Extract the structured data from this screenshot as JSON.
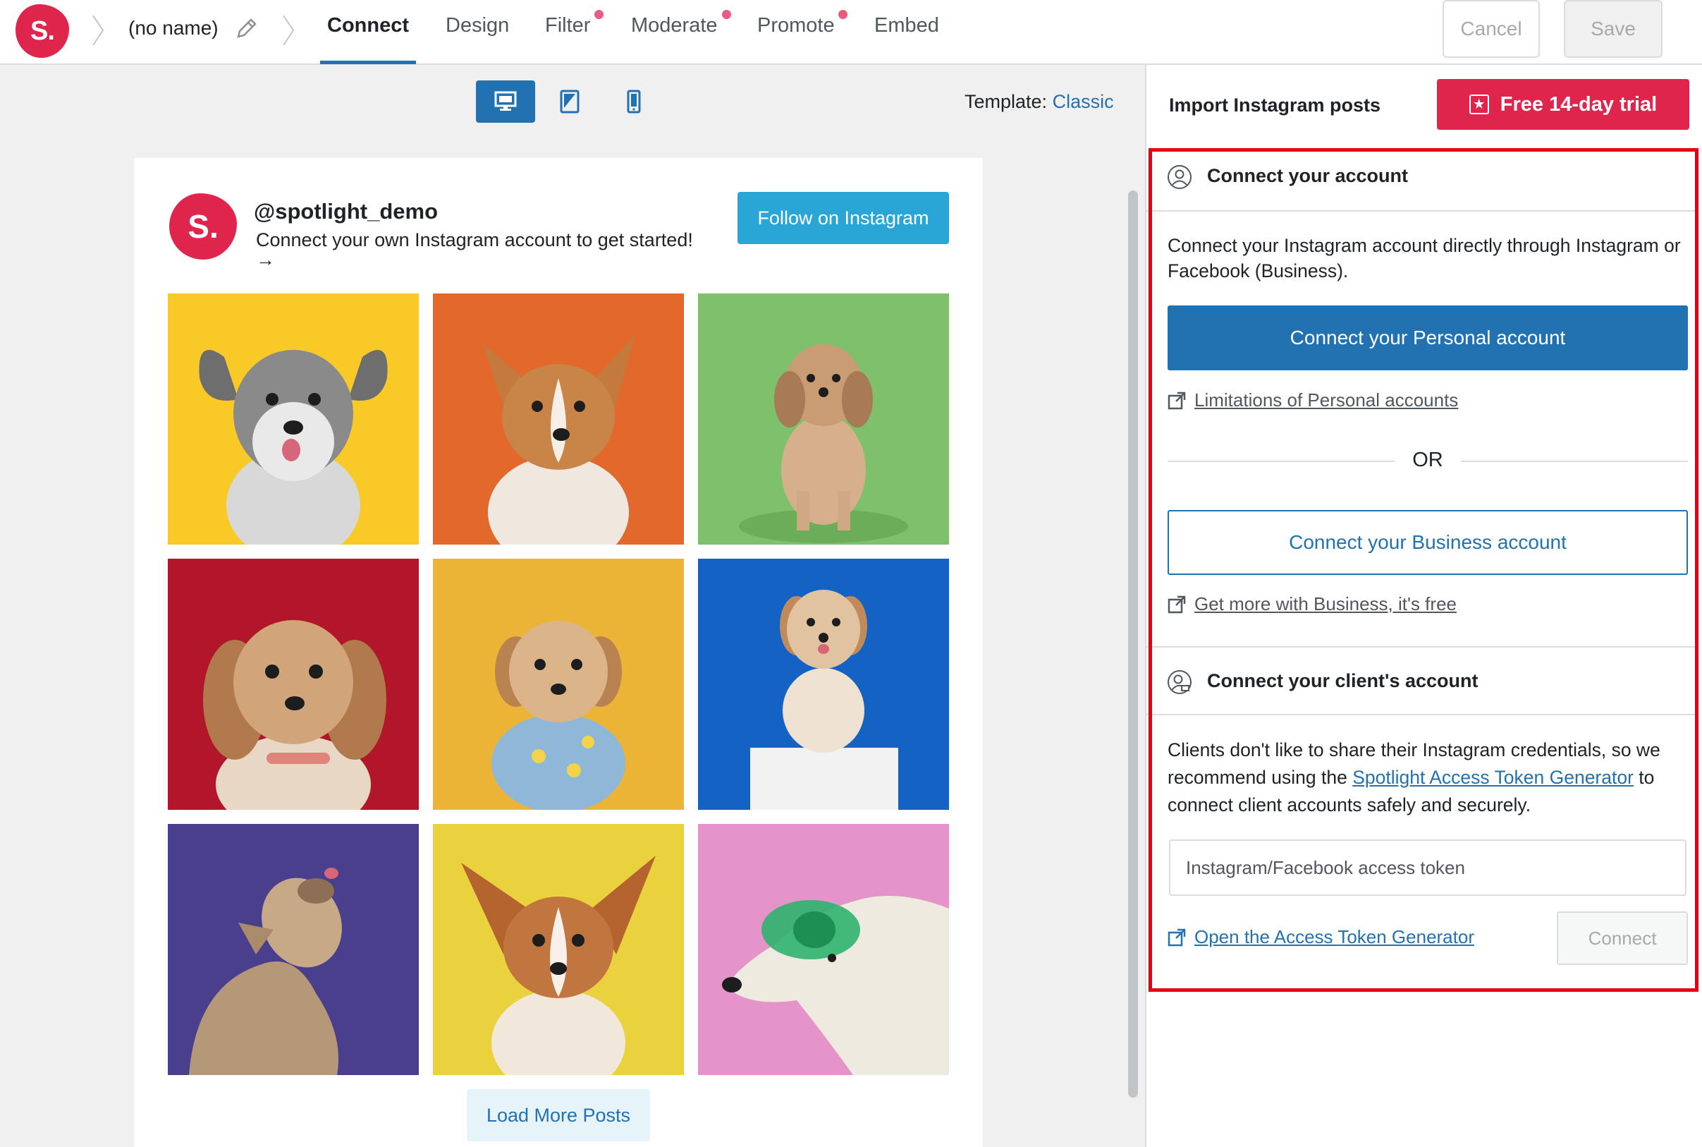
{
  "app": {
    "logo_text": "S.",
    "feed_name": "(no name)",
    "colors": {
      "brand": "#e0254c",
      "accent": "#2271b1",
      "highlight": "#e60012"
    }
  },
  "tabs": [
    {
      "label": "Connect",
      "active": true,
      "dot": false
    },
    {
      "label": "Design",
      "active": false,
      "dot": false
    },
    {
      "label": "Filter",
      "active": false,
      "dot": true
    },
    {
      "label": "Moderate",
      "active": false,
      "dot": true
    },
    {
      "label": "Promote",
      "active": false,
      "dot": true
    },
    {
      "label": "Embed",
      "active": false,
      "dot": false
    }
  ],
  "header_actions": {
    "cancel": "Cancel",
    "save": "Save"
  },
  "preview": {
    "devices": [
      "desktop-icon",
      "tablet-icon",
      "phone-icon"
    ],
    "active_device": "desktop",
    "template_label": "Template:",
    "template_value": "Classic"
  },
  "feed": {
    "logo_text": "S.",
    "username": "@spotlight_demo",
    "bio": "Connect your own Instagram account to get started!",
    "bio_arrow": "→",
    "follow_button": "Follow on Instagram",
    "load_more": "Load More Posts",
    "posts": [
      {
        "name": "schnauzer-photo",
        "bg": "#f9c927"
      },
      {
        "name": "corgi-orange-photo",
        "bg": "#e2682b"
      },
      {
        "name": "shihtzu-green-photo",
        "bg": "#7ec16a"
      },
      {
        "name": "shihtzu-red-photo",
        "bg": "#b1162b"
      },
      {
        "name": "puppy-sweater-photo",
        "bg": "#ecb437"
      },
      {
        "name": "puppy-blue-photo",
        "bg": "#1462c4"
      },
      {
        "name": "bulldog-purple-photo",
        "bg": "#4a3f8c"
      },
      {
        "name": "corgi-yellow-photo",
        "bg": "#ead23f"
      },
      {
        "name": "retriever-goggles-photo",
        "bg": "#e494c8"
      }
    ]
  },
  "sidebar": {
    "title": "Import Instagram posts",
    "trial_button": "Free 14-day trial",
    "connect_account": {
      "heading": "Connect your account",
      "description": "Connect your Instagram account directly through Instagram or Facebook (Business).",
      "personal_button": "Connect your Personal account",
      "personal_link": "Limitations of Personal accounts",
      "or_text": "OR",
      "business_button": "Connect your Business account",
      "business_link": "Get more with Business, it's free"
    },
    "client_account": {
      "heading": "Connect your client's account",
      "desc_before": "Clients don't like to share their Instagram credentials, so we recommend using the ",
      "desc_link": "Spotlight Access Token Generator",
      "desc_after": " to connect client accounts safely and securely.",
      "token_placeholder": "Instagram/Facebook access token",
      "token_value": "",
      "generator_link": "Open the Access Token Generator",
      "connect_button": "Connect"
    }
  }
}
